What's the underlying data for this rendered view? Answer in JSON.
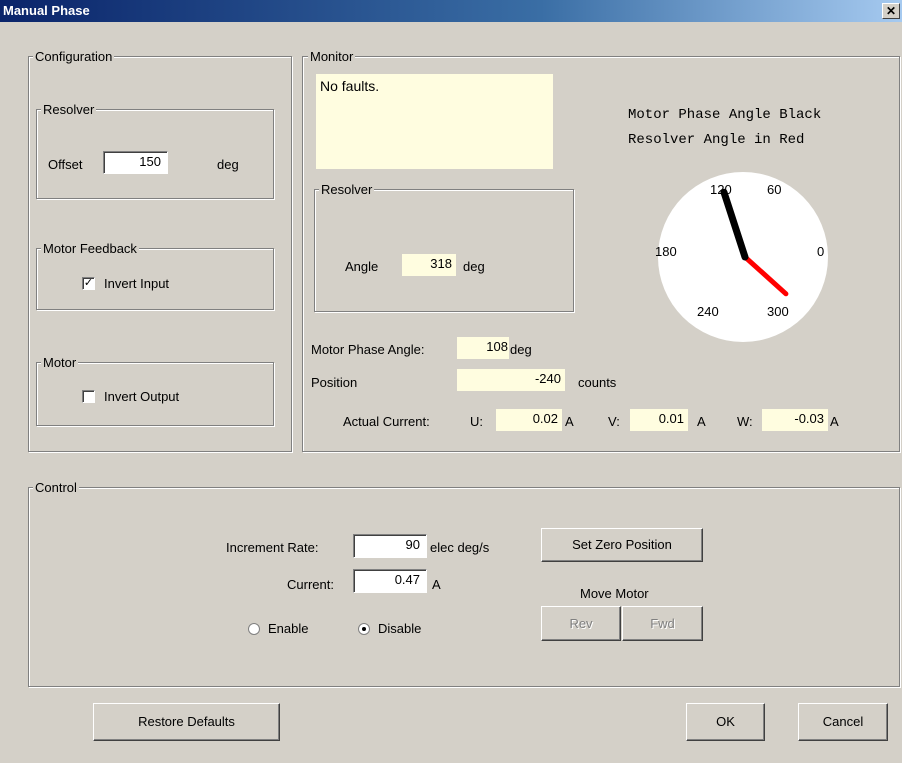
{
  "window": {
    "title": "Manual Phase",
    "close": "✕"
  },
  "configuration": {
    "label": "Configuration",
    "resolver": {
      "label": "Resolver",
      "offset_label": "Offset",
      "offset_value": "150",
      "unit": "deg"
    },
    "motor_feedback": {
      "label": "Motor Feedback",
      "invert_input_label": "Invert Input",
      "invert_input_checked": true
    },
    "motor": {
      "label": "Motor",
      "invert_output_label": "Invert Output",
      "invert_output_checked": false
    }
  },
  "monitor": {
    "label": "Monitor",
    "status_text": "No faults.",
    "resolver": {
      "label": "Resolver",
      "angle_label": "Angle",
      "angle_value": "318",
      "unit": "deg"
    },
    "dial": {
      "caption_line1": "Motor Phase Angle Black",
      "caption_line2": "Resolver Angle in Red",
      "ticks": [
        "120",
        "60",
        "180",
        "0",
        "240",
        "300"
      ],
      "motor_phase_angle": 108,
      "resolver_angle": 318,
      "motor_color": "#000000",
      "resolver_color": "#ff0000"
    },
    "motor_phase_angle_label": "Motor Phase Angle:",
    "motor_phase_angle_value": "108",
    "motor_phase_angle_unit": "deg",
    "position_label": "Position",
    "position_value": "-240",
    "position_unit": "counts",
    "actual_current_label": "Actual Current:",
    "u_label": "U:",
    "u_value": "0.02",
    "u_unit": "A",
    "v_label": "V:",
    "v_value": "0.01",
    "v_unit": "A",
    "w_label": "W:",
    "w_value": "-0.03",
    "w_unit": "A"
  },
  "control": {
    "label": "Control",
    "increment_rate_label": "Increment Rate:",
    "increment_rate_value": "90",
    "increment_rate_unit": "elec deg/s",
    "current_label": "Current:",
    "current_value": "0.47",
    "current_unit": "A",
    "enable_label": "Enable",
    "disable_label": "Disable",
    "mode_selected": "Disable",
    "set_zero_label": "Set Zero Position",
    "move_motor_label": "Move Motor",
    "rev_label": "Rev",
    "fwd_label": "Fwd"
  },
  "footer": {
    "restore_label": "Restore Defaults",
    "ok_label": "OK",
    "cancel_label": "Cancel"
  }
}
